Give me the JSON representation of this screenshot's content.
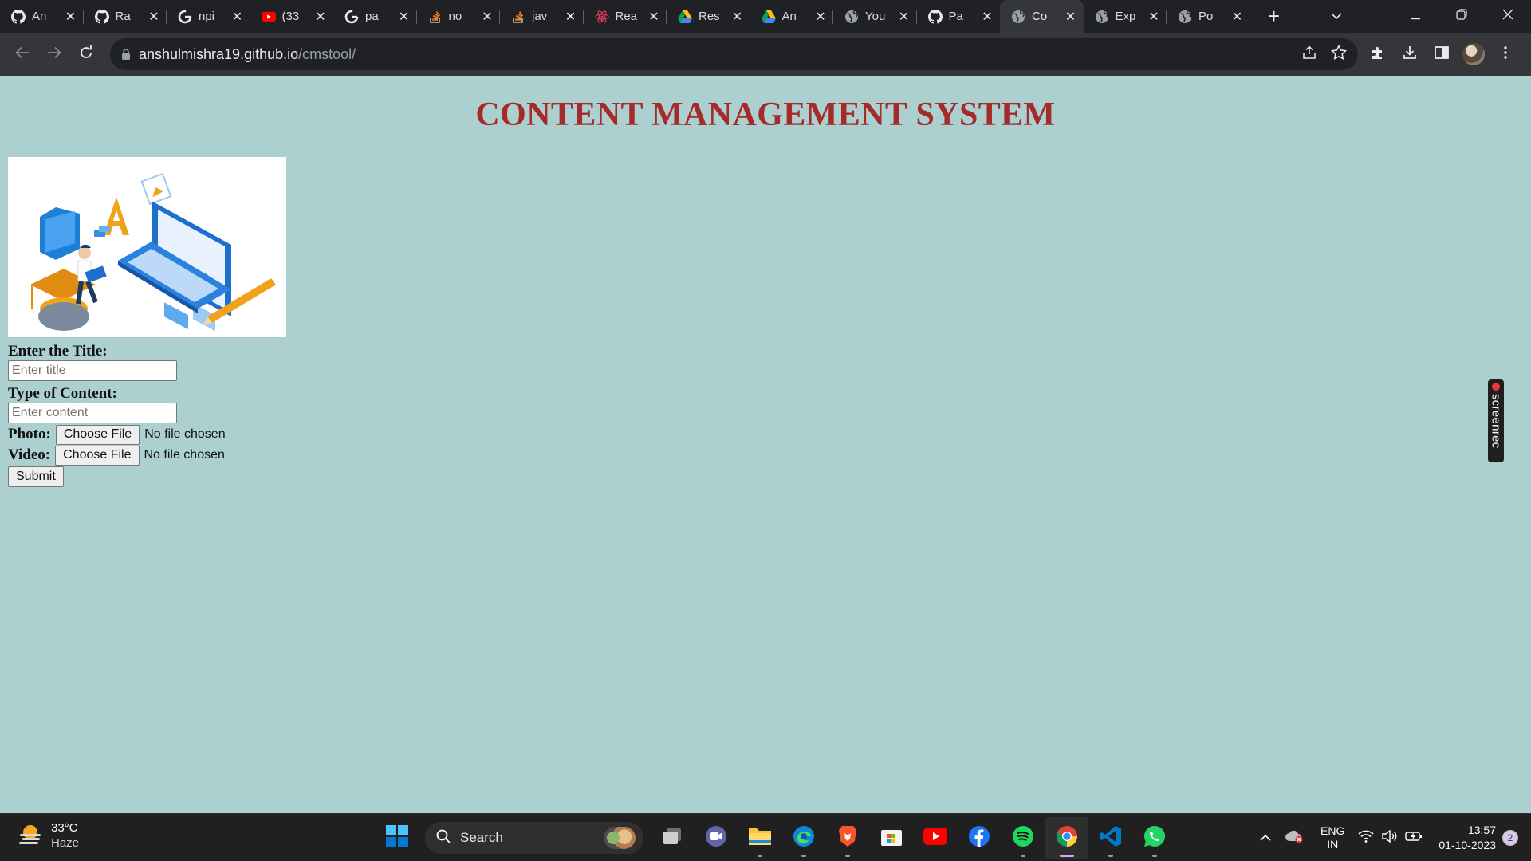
{
  "browser": {
    "tabs": [
      {
        "title": "An",
        "icon": "github-icon"
      },
      {
        "title": "Ra",
        "icon": "github-icon"
      },
      {
        "title": "npi",
        "icon": "google-icon"
      },
      {
        "title": "(33",
        "icon": "youtube-icon"
      },
      {
        "title": "pa",
        "icon": "google-icon"
      },
      {
        "title": "no",
        "icon": "stackoverflow-icon"
      },
      {
        "title": "jav",
        "icon": "stackoverflow-icon"
      },
      {
        "title": "Rea",
        "icon": "react-icon"
      },
      {
        "title": "Res",
        "icon": "google-drive-icon"
      },
      {
        "title": "An",
        "icon": "google-drive-icon"
      },
      {
        "title": "You",
        "icon": "globe-icon"
      },
      {
        "title": "Pa",
        "icon": "github-icon"
      },
      {
        "title": "Co",
        "icon": "globe-icon",
        "active": true
      },
      {
        "title": "Exp",
        "icon": "globe-icon"
      },
      {
        "title": "Po",
        "icon": "globe-icon"
      }
    ],
    "new_tab_label": "+",
    "close_glyph": "✕",
    "url_host": "anshulmishra19.github.io",
    "url_path": "/cmstool/"
  },
  "page": {
    "title": "CONTENT MANAGEMENT SYSTEM",
    "form": {
      "title_label": "Enter the Title:",
      "title_placeholder": "Enter title",
      "content_label": "Type of Content:",
      "content_placeholder": "Enter content",
      "photo_label": "Photo:",
      "video_label": "Video:",
      "choose_file_label": "Choose File",
      "no_file_text": "No file chosen",
      "submit_label": "Submit"
    },
    "title_color": "#a52a2a",
    "background_color": "#acd0cf"
  },
  "screenrec": {
    "label": "screenrec"
  },
  "taskbar": {
    "weather": {
      "temp": "33°C",
      "condition": "Haze"
    },
    "search_label": "Search",
    "apps": [
      "task-view-icon",
      "teams-meet-icon",
      "file-explorer-icon",
      "edge-icon",
      "brave-icon",
      "microsoft-store-icon",
      "youtube-icon",
      "facebook-icon",
      "spotify-icon",
      "chrome-icon",
      "vscode-icon",
      "whatsapp-icon"
    ],
    "language": {
      "line1": "ENG",
      "line2": "IN"
    },
    "clock": {
      "time": "13:57",
      "date": "01-10-2023"
    },
    "notification_count": "2"
  }
}
